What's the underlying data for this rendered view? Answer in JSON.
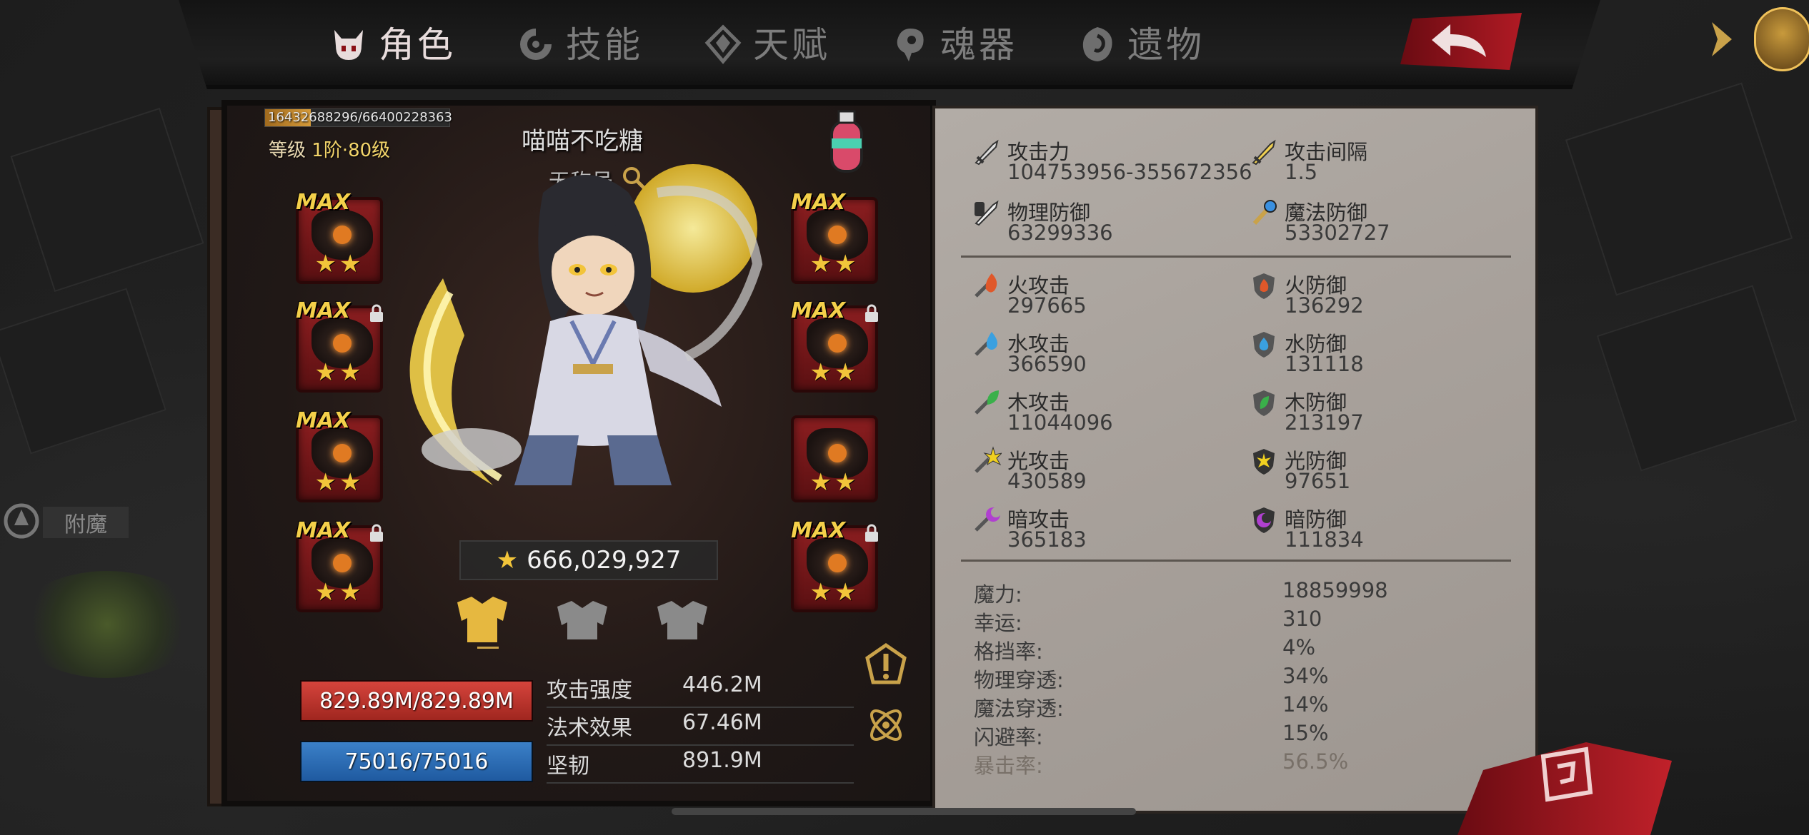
{
  "tabs": [
    {
      "label": "角色",
      "icon": "demon-icon",
      "active": true
    },
    {
      "label": "技能",
      "icon": "swirl-icon",
      "active": false
    },
    {
      "label": "天赋",
      "icon": "diamond-icon",
      "active": false
    },
    {
      "label": "魂器",
      "icon": "soul-icon",
      "active": false
    },
    {
      "label": "遗物",
      "icon": "relic-icon",
      "active": false
    }
  ],
  "character": {
    "exp": "16432688296/66400228363",
    "exp_progress": 0.247,
    "level_prefix": "等级",
    "level_value": "1阶·80级",
    "name": "喵喵不吃糖",
    "title": "无称号",
    "power": "666,029,927"
  },
  "equipment": {
    "max_label": "MAX",
    "stars": "★★"
  },
  "vitals": {
    "hp": "829.89M/829.89M",
    "mp": "75016/75016",
    "hp_color": "#c63a32",
    "mp_color": "#2f6fb6"
  },
  "mini_stats": [
    {
      "label": "攻击强度",
      "value": "446.2M"
    },
    {
      "label": "法术效果",
      "value": "67.46M"
    },
    {
      "label": "坚韧",
      "value": "891.9M"
    }
  ],
  "enchant": {
    "label": "附魔"
  },
  "stats_primary": [
    {
      "label": "攻击力",
      "value": "104753956-355672356",
      "icon": "sword-icon"
    },
    {
      "label": "攻击间隔",
      "value": "1.5",
      "icon": "golden-sword-icon"
    },
    {
      "label": "物理防御",
      "value": "63299336",
      "icon": "shield-sword-icon"
    },
    {
      "label": "魔法防御",
      "value": "53302727",
      "icon": "magic-staff-icon"
    }
  ],
  "stats_elemental": [
    {
      "label": "火攻击",
      "value": "297665",
      "icon": "fire-attack-icon",
      "color": "#e0582a"
    },
    {
      "label": "火防御",
      "value": "136292",
      "icon": "fire-defense-icon",
      "color": "#e0582a"
    },
    {
      "label": "水攻击",
      "value": "366590",
      "icon": "water-attack-icon",
      "color": "#3aa0e0"
    },
    {
      "label": "水防御",
      "value": "131118",
      "icon": "water-defense-icon",
      "color": "#3aa0e0"
    },
    {
      "label": "木攻击",
      "value": "11044096",
      "icon": "wood-attack-icon",
      "color": "#3ab04a"
    },
    {
      "label": "木防御",
      "value": "213197",
      "icon": "wood-defense-icon",
      "color": "#3ab04a"
    },
    {
      "label": "光攻击",
      "value": "430589",
      "icon": "light-attack-icon",
      "color": "#f0d020"
    },
    {
      "label": "光防御",
      "value": "97651",
      "icon": "light-defense-icon",
      "color": "#f0d020"
    },
    {
      "label": "暗攻击",
      "value": "365183",
      "icon": "dark-attack-icon",
      "color": "#b040d0"
    },
    {
      "label": "暗防御",
      "value": "111834",
      "icon": "dark-defense-icon",
      "color": "#b040d0"
    }
  ],
  "stats_misc": [
    {
      "label": "魔力:",
      "value": "18859998"
    },
    {
      "label": "幸运:",
      "value": "310"
    },
    {
      "label": "格挡率:",
      "value": "4%"
    },
    {
      "label": "物理穿透:",
      "value": "34%"
    },
    {
      "label": "魔法穿透:",
      "value": "14%"
    },
    {
      "label": "闪避率:",
      "value": "15%"
    },
    {
      "label": "暴击率:",
      "value": "56.5%"
    }
  ]
}
